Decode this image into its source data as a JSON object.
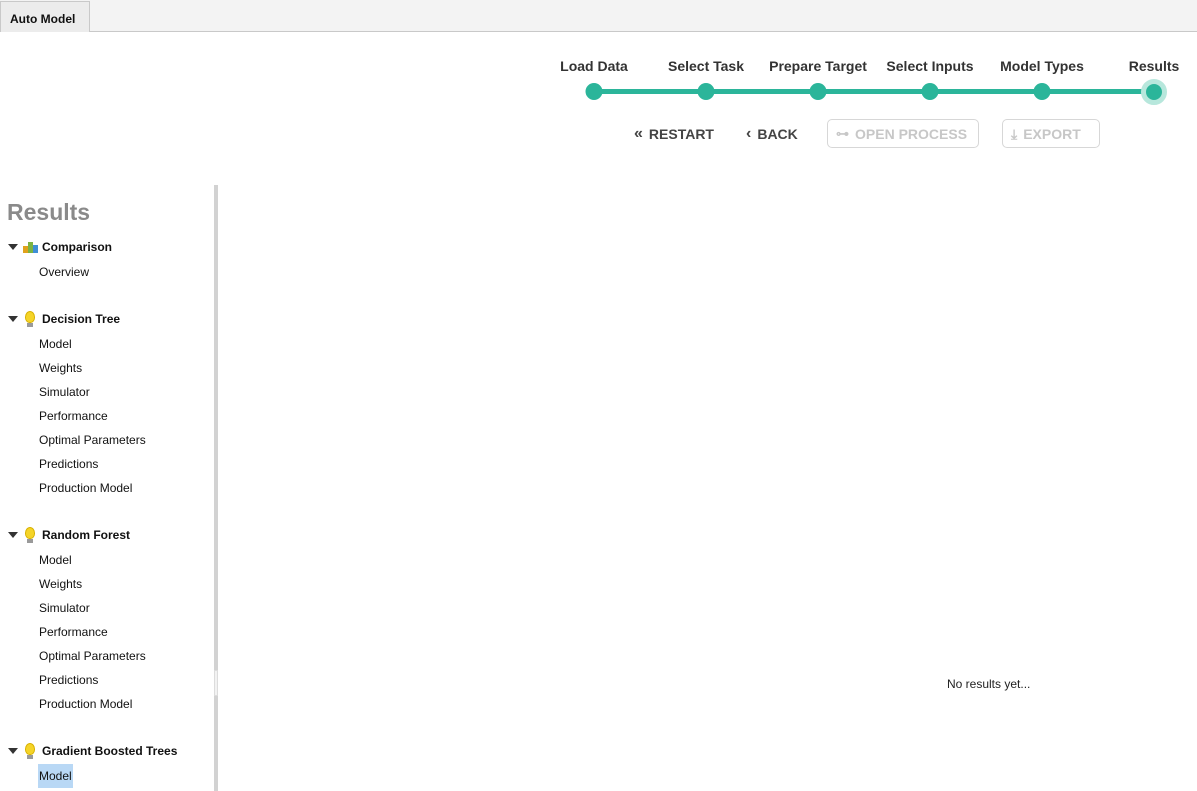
{
  "tab": {
    "label": "Auto Model"
  },
  "stepper": {
    "steps": [
      "Load Data",
      "Select Task",
      "Prepare Target",
      "Select Inputs",
      "Model Types",
      "Results"
    ],
    "current_step": "Results",
    "color": "#2bb59a"
  },
  "actions": {
    "restart": "RESTART",
    "back": "BACK",
    "open_process": "OPEN PROCESS",
    "export": "EXPORT"
  },
  "sidebar": {
    "title": "Results",
    "groups": [
      {
        "label": "Comparison",
        "icon": "comparison-chart-icon",
        "items": [
          "Overview"
        ]
      },
      {
        "label": "Decision Tree",
        "icon": "lightbulb-icon",
        "items": [
          "Model",
          "Weights",
          "Simulator",
          "Performance",
          "Optimal Parameters",
          "Predictions",
          "Production Model"
        ]
      },
      {
        "label": "Random Forest",
        "icon": "lightbulb-icon",
        "items": [
          "Model",
          "Weights",
          "Simulator",
          "Performance",
          "Optimal Parameters",
          "Predictions",
          "Production Model"
        ]
      },
      {
        "label": "Gradient Boosted Trees",
        "icon": "lightbulb-icon",
        "items": [
          "Model"
        ]
      }
    ],
    "selected": "Gradient Boosted Trees / Model"
  },
  "main": {
    "empty_message": "No results yet..."
  }
}
